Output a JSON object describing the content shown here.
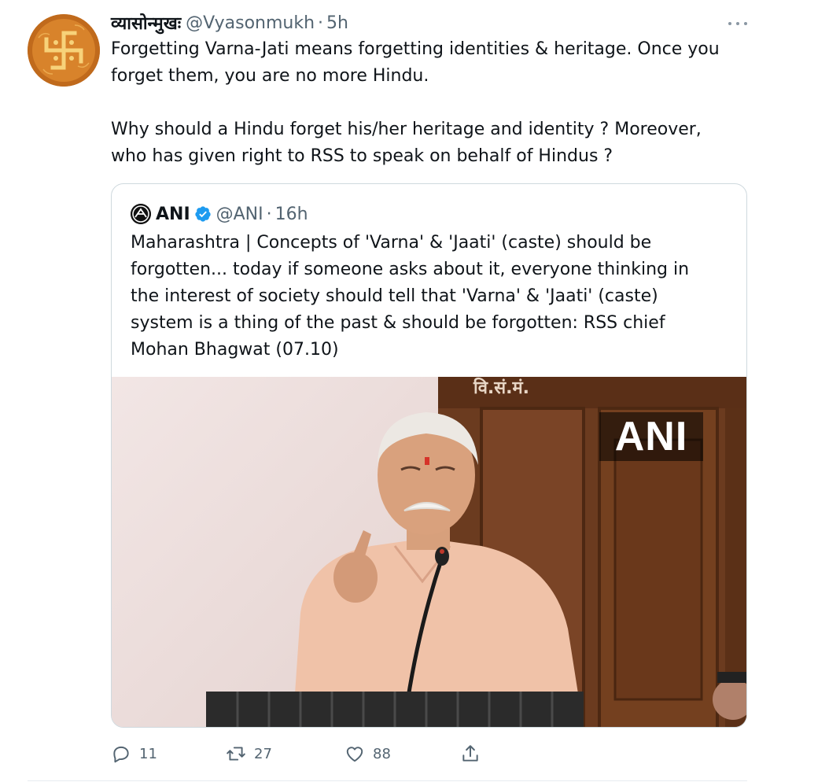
{
  "tweet": {
    "display_name": "व्यासोन्मुखः",
    "handle": "@Vyasonmukh",
    "separator": "·",
    "time": "5h",
    "text_lines": [
      "Forgetting Varna-Jati means forgetting identities & heritage. Once you",
      "forget them, you are no more Hindu.",
      "",
      "Why should a Hindu forget his/her heritage and identity ? Moreover,",
      "who has given right to RSS to speak on behalf of Hindus ?"
    ],
    "avatar_icon": "swastika-icon"
  },
  "quote": {
    "display_name": "ANI",
    "handle": "@ANI",
    "separator": "·",
    "time": "16h",
    "verified_icon": "verified-badge-icon",
    "text_lines": [
      "Maharashtra | Concepts of 'Varna' & 'Jaati' (caste) should be",
      "forgotten... today if someone asks about it, everyone thinking in",
      "the interest of society should tell that 'Varna' & 'Jaati' (caste)",
      "system is a thing of the past & should be forgotten: RSS chief",
      "Mohan Bhagwat (07.10)"
    ],
    "media": {
      "watermark": "ANI",
      "sign_text": "वि.सं.मं."
    }
  },
  "actions": {
    "reply_count": "11",
    "retweet_count": "27",
    "like_count": "88",
    "icons": [
      "reply-icon",
      "retweet-icon",
      "like-icon",
      "share-icon"
    ]
  },
  "colors": {
    "text": "#0f1419",
    "secondary": "#536471",
    "border": "#cfd9de",
    "verified": "#1d9bf0"
  }
}
